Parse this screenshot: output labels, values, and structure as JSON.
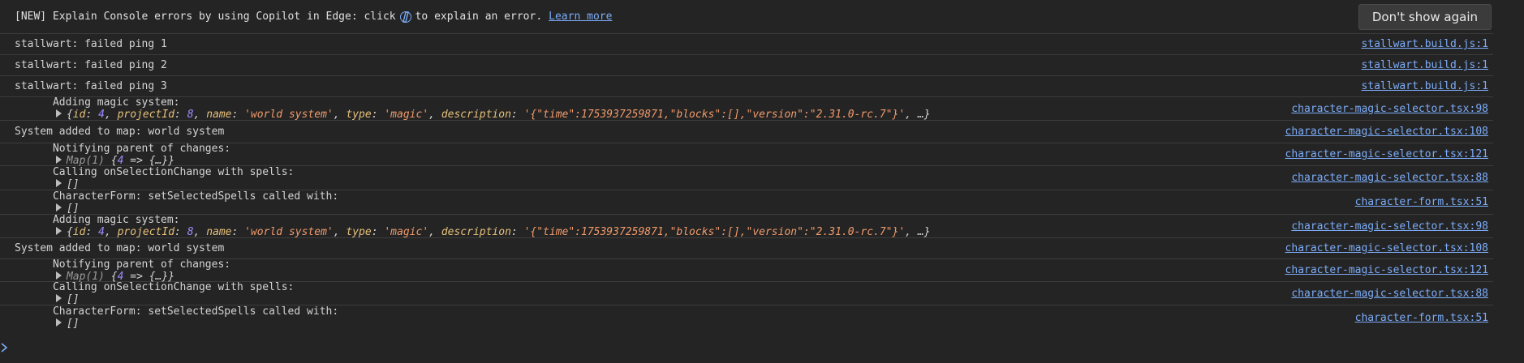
{
  "banner": {
    "prefix": "[NEW] Explain Console errors by using Copilot in Edge: click",
    "suffix": "to explain an error.",
    "learn_more": "Learn more",
    "dont_show_again": "Don't show again"
  },
  "rows": [
    {
      "text": "stallwart: failed ping 1",
      "source": "stallwart.build.js:1"
    },
    {
      "text": "stallwart: failed ping 2",
      "source": "stallwart.build.js:1"
    },
    {
      "text": "stallwart: failed ping 3",
      "source": "stallwart.build.js:1"
    },
    {
      "text": "Adding magic system:",
      "source": "character-magic-selector.tsx:98",
      "obj": {
        "open": "{",
        "k_id": "id",
        "v_id": "4",
        "k_projectId": "projectId",
        "v_projectId": "8",
        "k_name": "name",
        "v_name": "'world system'",
        "k_type": "type",
        "v_type": "'magic'",
        "k_description": "description",
        "v_description": "'{\"time\":1753937259871,\"blocks\":[],\"version\":\"2.31.0-rc.7\"}'",
        "close": ", …}"
      }
    },
    {
      "text": "System added to map: world system",
      "source": "character-magic-selector.tsx:108"
    },
    {
      "text": "Notifying parent of changes:",
      "source": "character-magic-selector.tsx:121",
      "map": {
        "label": "Map(1)",
        "body": "{4 => {…}}",
        "num": "4"
      }
    },
    {
      "text": "Calling onSelectionChange with spells:",
      "source": "character-magic-selector.tsx:88",
      "arr": "[]"
    },
    {
      "text": "CharacterForm: setSelectedSpells called with:",
      "source": "character-form.tsx:51",
      "arr": "[]"
    },
    {
      "text": "Adding magic system:",
      "source": "character-magic-selector.tsx:98"
    },
    {
      "text": "System added to map: world system",
      "source": "character-magic-selector.tsx:108"
    },
    {
      "text": "Notifying parent of changes:",
      "source": "character-magic-selector.tsx:121"
    },
    {
      "text": "Calling onSelectionChange with spells:",
      "source": "character-magic-selector.tsx:88",
      "arr": "[]"
    },
    {
      "text": "CharacterForm: setSelectedSpells called with:",
      "source": "character-form.tsx:51",
      "arr": "[]"
    }
  ]
}
